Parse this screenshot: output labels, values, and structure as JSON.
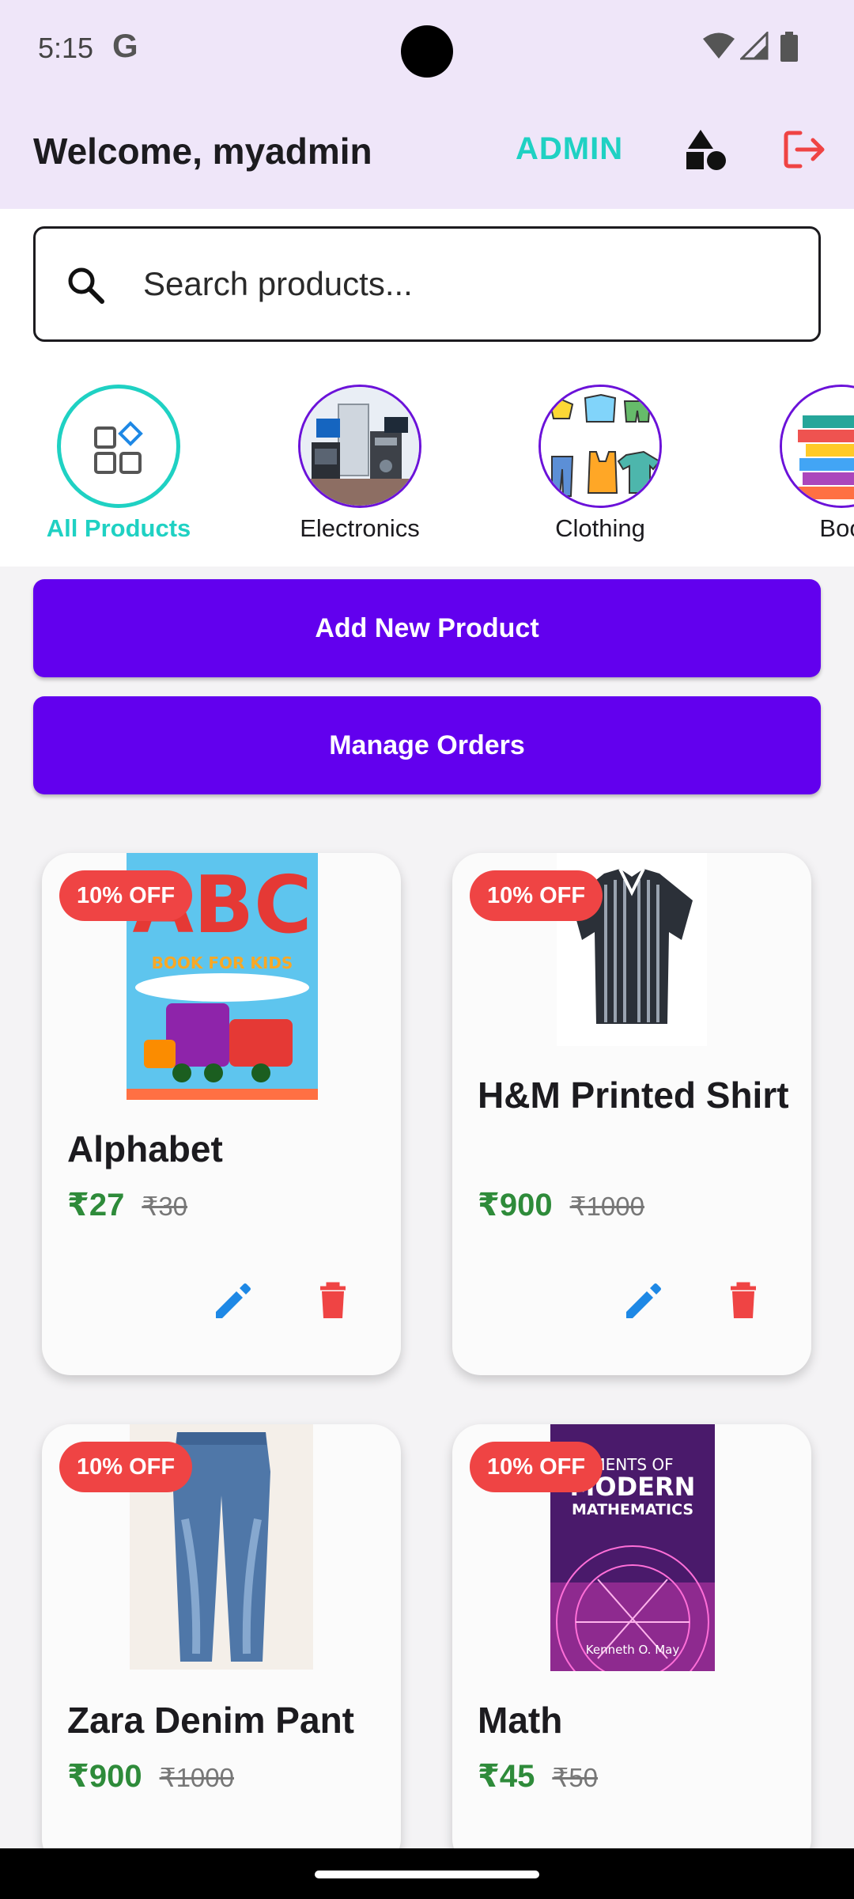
{
  "status": {
    "time": "5:15",
    "g_icon": "google-g-icon"
  },
  "header": {
    "welcome": "Welcome, myadmin",
    "admin_link": "ADMIN",
    "shapes_icon": "shapes-icon",
    "logout_icon": "logout-icon",
    "accent_color": "#1fd1c3",
    "logout_color": "#ef4444"
  },
  "search": {
    "placeholder": "Search products..."
  },
  "categories": [
    {
      "label": "All Products",
      "icon": "grid-icon",
      "active": true
    },
    {
      "label": "Electronics",
      "icon": "electronics-icon",
      "active": false
    },
    {
      "label": "Clothing",
      "icon": "clothing-icon",
      "active": false
    },
    {
      "label": "Boo",
      "icon": "books-icon",
      "active": false
    }
  ],
  "actions": {
    "add_product": "Add New Product",
    "manage_orders": "Manage Orders",
    "color": "#6200ee"
  },
  "products": [
    {
      "name": "Alphabet",
      "price": "₹27",
      "old_price": "₹30",
      "discount": "10% OFF"
    },
    {
      "name": "H&M Printed Shirt",
      "price": "₹900",
      "old_price": "₹1000",
      "discount": "10% OFF"
    },
    {
      "name": "Zara Denim Pant",
      "price": "₹900",
      "old_price": "₹1000",
      "discount": "10% OFF"
    },
    {
      "name": "Math",
      "price": "₹45",
      "old_price": "₹50",
      "discount": "10% OFF"
    }
  ],
  "book_art": {
    "abc_title": "ABC",
    "abc_subtitle": "BOOK FOR KIDS",
    "math_line1": "MENTS OF",
    "math_line2": "MODERN",
    "math_line3": "MATHEMATICS",
    "math_author": "Kenneth O. May"
  }
}
